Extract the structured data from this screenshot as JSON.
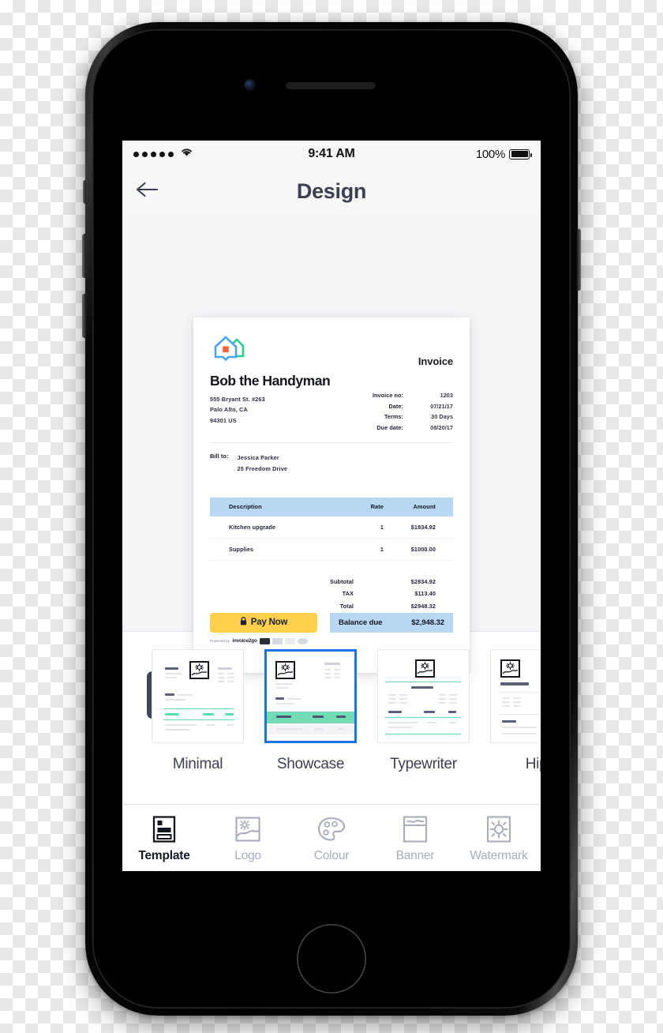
{
  "status_bar": {
    "signal_dots": 5,
    "wifi_icon": "wifi-icon",
    "time": "9:41 AM",
    "battery_percent": "100%"
  },
  "nav": {
    "back_icon": "arrow-left-icon",
    "title": "Design"
  },
  "preview": {
    "zoom_button_icon": "magnify-plus-icon"
  },
  "invoice": {
    "logo_icon": "house-logo-icon",
    "heading": "Invoice",
    "business_name": "Bob the Handyman",
    "address_lines": [
      "555 Bryant St. #263",
      "Palo Alto, CA",
      "94301 US"
    ],
    "meta": [
      {
        "key": "Invoice no:",
        "value": "1203"
      },
      {
        "key": "Date:",
        "value": "07/21/17"
      },
      {
        "key": "Terms:",
        "value": "30 Days"
      },
      {
        "key": "Due date:",
        "value": "08/20/17"
      }
    ],
    "bill_to_label": "Bill to:",
    "bill_to_lines": [
      "Jessica Parker",
      "25 Freedom Drive"
    ],
    "table": {
      "headers": [
        "Description",
        "Rate",
        "Amount"
      ],
      "rows": [
        {
          "description": "Kitchen upgrade",
          "rate": "1",
          "amount": "$1834.92"
        },
        {
          "description": "Supplies",
          "rate": "1",
          "amount": "$1000.00"
        }
      ]
    },
    "totals": [
      {
        "key": "Subtotal",
        "value": "$2834.92"
      },
      {
        "key": "TAX",
        "value": "$113.40"
      },
      {
        "key": "Total",
        "value": "$2948.32"
      }
    ],
    "pay_button": {
      "label": "Pay Now",
      "lock_icon": "lock-icon",
      "color": "#ffd04d"
    },
    "powered_by": {
      "prefix": "Powered by",
      "brand": "invoice2go",
      "cards": [
        "amex-card-icon",
        "mastercard-card-icon",
        "visa-card-icon",
        "discover-card-icon"
      ]
    },
    "balance": {
      "label": "Balance due",
      "value": "$2,948.32",
      "color": "#b8d7f3"
    },
    "table_header_color": "#b8d7f3",
    "accent_green": "#1fd18b",
    "accent_blue": "#4aa3f0",
    "accent_orange": "#f4643c"
  },
  "templates": {
    "selected": "Showcase",
    "selected_border_color": "#1a73e8",
    "items": [
      {
        "label": "Minimal",
        "thumb_icon": "invoice-thumbnail-icon",
        "selected": false
      },
      {
        "label": "Showcase",
        "thumb_icon": "invoice-thumbnail-icon",
        "selected": true
      },
      {
        "label": "Typewriter",
        "thumb_icon": "invoice-thumbnail-icon",
        "selected": false
      },
      {
        "label": "Hip",
        "thumb_icon": "invoice-thumbnail-icon",
        "selected": false
      }
    ]
  },
  "tabbar": {
    "items": [
      {
        "label": "Template",
        "icon": "template-icon",
        "active": true
      },
      {
        "label": "Logo",
        "icon": "logo-image-icon",
        "active": false
      },
      {
        "label": "Colour",
        "icon": "palette-icon",
        "active": false
      },
      {
        "label": "Banner",
        "icon": "banner-icon",
        "active": false
      },
      {
        "label": "Watermark",
        "icon": "watermark-sun-icon",
        "active": false
      }
    ]
  }
}
